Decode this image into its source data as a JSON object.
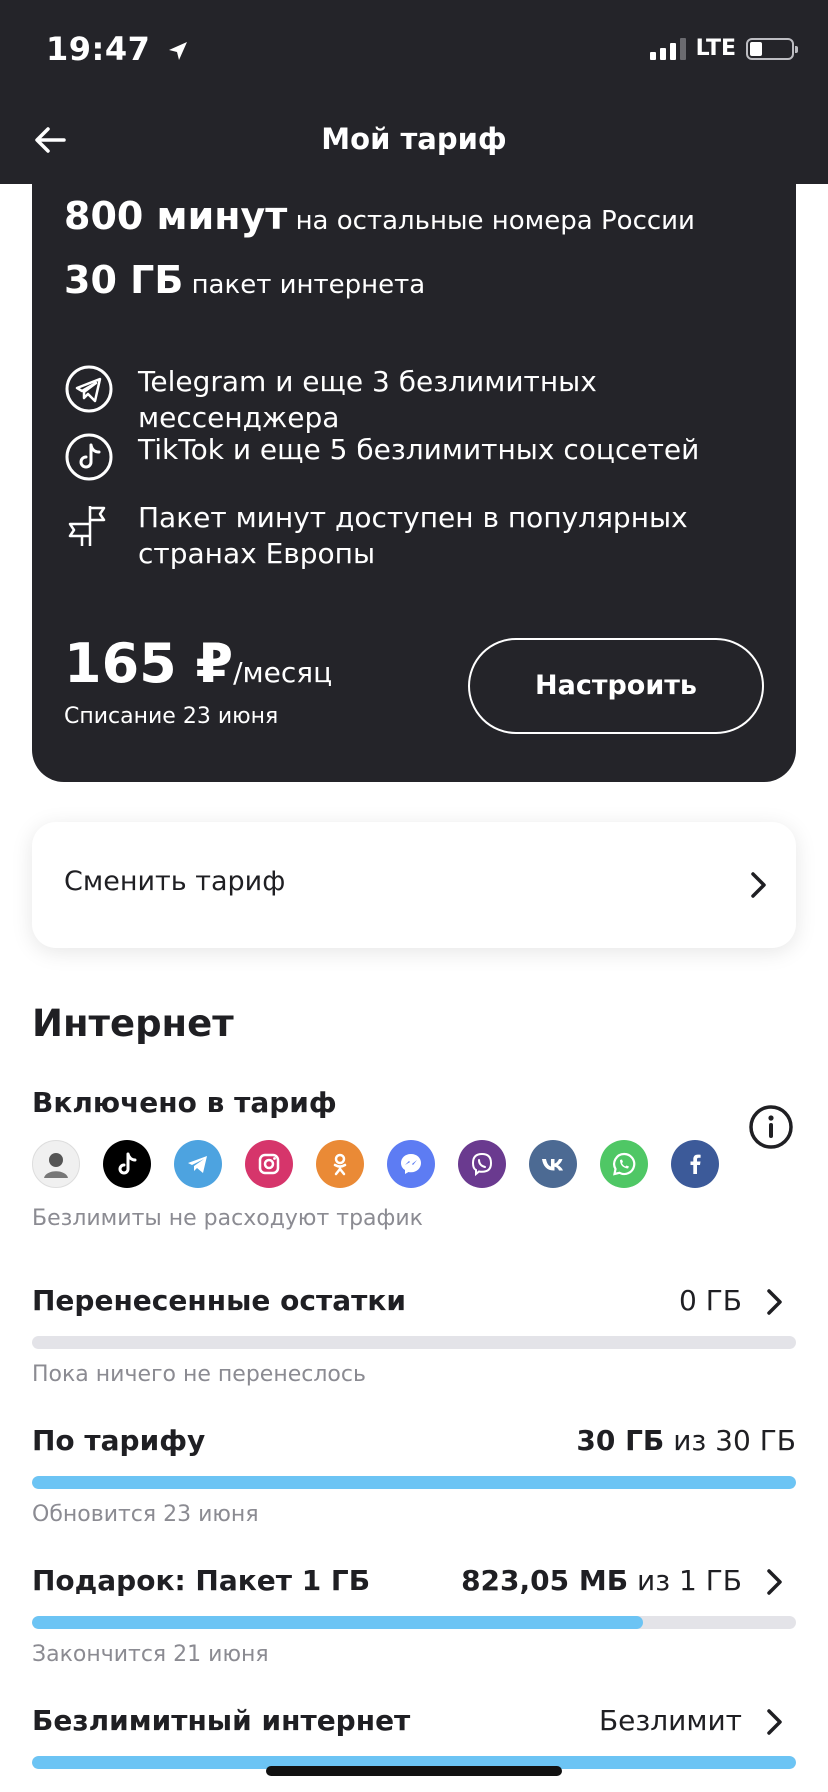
{
  "status_bar": {
    "time": "19:47",
    "network": "LTE"
  },
  "header": {
    "title": "Мой тариф"
  },
  "tariff": {
    "minutes_value": "800 минут",
    "minutes_text": "на остальные номера России",
    "internet_value": "30 ГБ",
    "internet_text": "пакет интернета",
    "features": [
      {
        "text": "Telegram и еще 3 безлимитных мессенджера"
      },
      {
        "text": "TikTok и еще 5 безлимитных соцсетей"
      },
      {
        "text": "Пакет минут доступен в популярных странах Европы"
      }
    ],
    "price_value": "165 ₽",
    "price_unit": "/месяц",
    "charge_date": "Списание 23 июня",
    "setup_label": "Настроить"
  },
  "change_tariff": {
    "label": "Сменить тариф"
  },
  "internet": {
    "title": "Интернет",
    "included_title": "Включено в тариф",
    "apps": [
      "avatar",
      "tiktok-icon",
      "telegram-icon",
      "instagram-icon",
      "odnoklassniki-icon",
      "messenger-icon",
      "viber-icon",
      "vk-icon",
      "whatsapp-icon",
      "facebook-icon"
    ],
    "apps_note": "Безлимиты не расходуют трафик",
    "rows": [
      {
        "title": "Перенесенные остатки",
        "value_bold": "",
        "value_text": "0 ГБ",
        "sub": "Пока ничего не перенеслось",
        "progress": 0
      },
      {
        "title": "По тарифу",
        "value_bold": "30 ГБ",
        "value_text": "из 30 ГБ",
        "sub": "Обновится 23 июня",
        "progress": 1.0
      },
      {
        "title": "Подарок: Пакет 1 ГБ",
        "value_bold": "823,05 МБ",
        "value_text": "из 1 ГБ",
        "sub": "Закончится 21 июня",
        "progress": 0.8
      },
      {
        "title": "Безлимитный интернет",
        "value_bold": "",
        "value_text": "Безлимит",
        "sub": "",
        "progress": 1.0
      }
    ]
  },
  "colors": {
    "dark": "#242429",
    "progress": "#6cc4f4",
    "track": "#e3e3e8"
  }
}
